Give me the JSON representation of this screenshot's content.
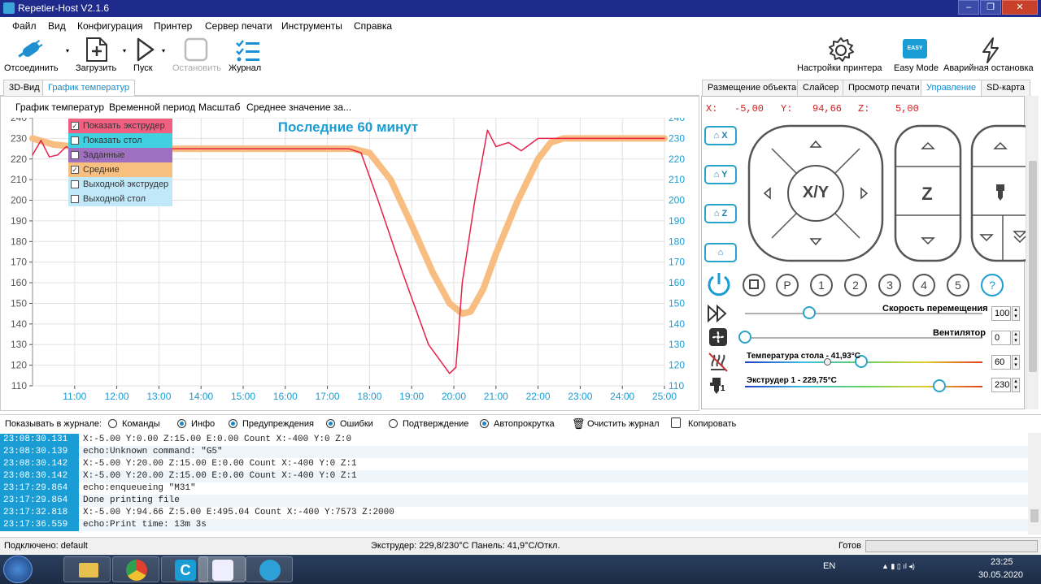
{
  "window": {
    "title": "Repetier-Host V2.1.6"
  },
  "menu": [
    "Файл",
    "Вид",
    "Конфигурация",
    "Принтер",
    "Сервер печати",
    "Инструменты",
    "Справка"
  ],
  "toolbar": {
    "disconnect": "Отсоединить",
    "load": "Загрузить",
    "run": "Пуск",
    "stop": "Остановить",
    "log": "Журнал",
    "printer_settings": "Настройки принтера",
    "easy_mode": "Easy Mode",
    "easy_badge": "EASY",
    "emergency": "Аварийная остановка"
  },
  "left_tabs": [
    "3D-Вид",
    "График температур"
  ],
  "chart_menu": [
    "График температур",
    "Временной период",
    "Масштаб",
    "Среднее значение за..."
  ],
  "legend": [
    {
      "label": "Показать экструдер",
      "checked": true,
      "color": "#f06080"
    },
    {
      "label": "Показать стол",
      "checked": false,
      "color": "#40d0e0"
    },
    {
      "label": "Заданные",
      "checked": false,
      "color": "#a070c0"
    },
    {
      "label": "Средние",
      "checked": true,
      "color": "#f8c080"
    },
    {
      "label": "Выходной экструдер",
      "checked": false,
      "color": "#c0e8f8"
    },
    {
      "label": "Выходной стол",
      "checked": false,
      "color": "#c0e8f8"
    }
  ],
  "chart_data": {
    "type": "line",
    "title": "Последние 60 минут",
    "x_ticks": [
      "11:00",
      "12:00",
      "13:00",
      "14:00",
      "15:00",
      "16:00",
      "17:00",
      "18:00",
      "19:00",
      "20:00",
      "21:00",
      "22:00",
      "23:00",
      "24:00",
      "25:00"
    ],
    "y_ticks": [
      110,
      120,
      130,
      140,
      150,
      160,
      170,
      180,
      190,
      200,
      210,
      220,
      230,
      240
    ],
    "ylim": [
      110,
      240
    ],
    "xlim": [
      10.0,
      25.0
    ],
    "series": [
      {
        "name": "Показать экструдер",
        "color": "#e8204a",
        "x": [
          10.0,
          10.2,
          10.4,
          10.6,
          10.8,
          11.0,
          11.3,
          11.6,
          12.0,
          13.0,
          14.0,
          15.0,
          16.0,
          17.0,
          17.5,
          17.8,
          18.2,
          18.8,
          19.4,
          19.9,
          20.05,
          20.2,
          20.5,
          20.8,
          21.0,
          21.3,
          21.6,
          22.0,
          22.5,
          23.0,
          24.0,
          25.0
        ],
        "y": [
          222,
          229,
          221,
          222,
          226,
          224,
          226,
          225,
          225,
          225,
          225,
          225,
          225,
          225,
          225,
          223,
          200,
          164,
          130,
          116,
          119,
          160,
          200,
          234,
          226,
          228,
          224,
          230,
          230,
          230,
          230,
          230
        ]
      },
      {
        "name": "Средние",
        "color": "#f8bd80",
        "x": [
          10.0,
          10.5,
          11.0,
          11.5,
          12.0,
          13.0,
          14.0,
          15.0,
          16.0,
          17.0,
          17.6,
          18.0,
          18.5,
          19.0,
          19.5,
          19.9,
          20.2,
          20.4,
          20.7,
          21.0,
          21.5,
          22.0,
          22.3,
          22.6,
          23.0,
          24.0,
          25.0
        ],
        "y": [
          230,
          227,
          226,
          225,
          225,
          225,
          225,
          225,
          225,
          225,
          225,
          223,
          210,
          188,
          165,
          150,
          145,
          146,
          157,
          174,
          199,
          220,
          228,
          230,
          230,
          230,
          230
        ]
      }
    ]
  },
  "right_tabs": [
    "Размещение объекта",
    "Слайсер",
    "Просмотр печати",
    "Управление",
    "SD-карта"
  ],
  "coords": {
    "x_label": "X:",
    "x_value": "-5,00",
    "y_label": "Y:",
    "y_value": "94,66",
    "z_label": "Z:",
    "z_value": "5,00"
  },
  "home": {
    "x": "X",
    "y": "Y",
    "z": "Z"
  },
  "jog": {
    "xy": "X/Y",
    "z": "Z"
  },
  "preset_buttons": [
    "P",
    "1",
    "2",
    "3",
    "4",
    "5",
    "?"
  ],
  "sliders": {
    "speed_label": "Скорость перемещения",
    "speed_value": "100",
    "speed_level": 0.27,
    "fan_label": "Вентилятор",
    "fan_value": "0",
    "fan_level": 0.0,
    "bed_label": "Температура стола - 41,93°C",
    "bed_value": "60",
    "bed_level": 0.49,
    "ext_label": "Экструдер 1 - 229,75°C",
    "ext_value": "230",
    "ext_level": 0.82,
    "extruder_num": "1"
  },
  "log_toolbar": {
    "label": "Показывать в журнале:",
    "options": [
      {
        "label": "Команды",
        "on": false
      },
      {
        "label": "Инфо",
        "on": true
      },
      {
        "label": "Предупреждения",
        "on": true
      },
      {
        "label": "Ошибки",
        "on": true
      },
      {
        "label": "Подтверждение",
        "on": false
      },
      {
        "label": "Автопрокрутка",
        "on": true
      }
    ],
    "clear": "Очистить журнал",
    "copy": "Копировать"
  },
  "log": [
    {
      "ts": "23:08:30.131",
      "msg": "X:-5.00 Y:0.00 Z:15.00 E:0.00 Count X:-400 Y:0 Z:0"
    },
    {
      "ts": "23:08:30.139",
      "msg": "echo:Unknown command: \"G5\""
    },
    {
      "ts": "23:08:30.142",
      "msg": "X:-5.00 Y:20.00 Z:15.00 E:0.00 Count X:-400 Y:0 Z:1"
    },
    {
      "ts": "23:08:30.142",
      "msg": "X:-5.00 Y:20.00 Z:15.00 E:0.00 Count X:-400 Y:0 Z:1"
    },
    {
      "ts": "23:17:29.864",
      "msg": "echo:enqueueing \"M31\""
    },
    {
      "ts": "23:17:29.864",
      "msg": "Done printing file"
    },
    {
      "ts": "23:17:32.818",
      "msg": "X:-5.00 Y:94.66 Z:5.00 E:495.04 Count X:-400 Y:7573 Z:2000"
    },
    {
      "ts": "23:17:36.559",
      "msg": "echo:Print time: 13m 3s"
    }
  ],
  "status": {
    "connection": "Подключено: default",
    "temps": "Экструдер: 229,8/230°C Панель: 41,9°C/Откл.",
    "ready": "Готов"
  },
  "taskbar": {
    "lang": "EN",
    "time": "23:25",
    "date": "30.05.2020"
  }
}
